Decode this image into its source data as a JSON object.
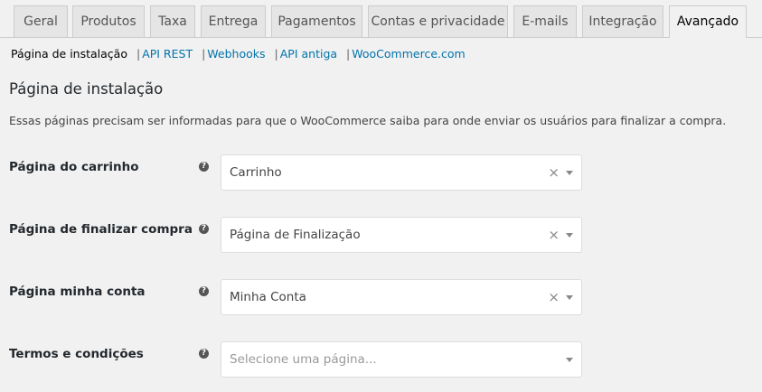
{
  "tabs": [
    {
      "label": "Geral"
    },
    {
      "label": "Produtos"
    },
    {
      "label": "Taxa"
    },
    {
      "label": "Entrega"
    },
    {
      "label": "Pagamentos"
    },
    {
      "label": "Contas e privacidade"
    },
    {
      "label": "E-mails"
    },
    {
      "label": "Integração"
    },
    {
      "label": "Avançado",
      "active": true
    }
  ],
  "subnav": {
    "current": "Página de instalação",
    "links": [
      "API REST",
      "Webhooks",
      "API antiga",
      "WooCommerce.com"
    ]
  },
  "section": {
    "title": "Página de instalação",
    "description": "Essas páginas precisam ser informadas para que o WooCommerce saiba para onde enviar os usuários para finalizar a compra."
  },
  "fields": [
    {
      "label": "Página do carrinho",
      "value": "Carrinho",
      "clearable": true
    },
    {
      "label": "Página de finalizar compra",
      "value": "Página de Finalização",
      "clearable": true
    },
    {
      "label": "Página minha conta",
      "value": "Minha Conta",
      "clearable": true
    },
    {
      "label": "Termos e condições",
      "placeholder": "Selecione uma página...",
      "clearable": false
    }
  ],
  "help_icon_glyph": "?",
  "clear_glyph": "×"
}
